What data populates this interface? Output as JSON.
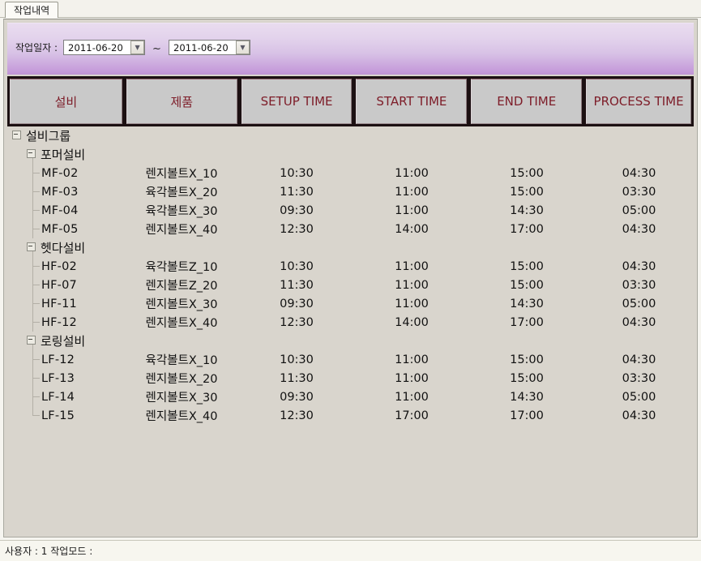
{
  "window": {
    "tab_label": "작업내역"
  },
  "filter": {
    "label": "작업일자 :",
    "date_from": "2011-06-20",
    "date_to": "2011-06-20",
    "separator": "~",
    "dropdown_glyph": "▼",
    "accent_color": "#c79fdb"
  },
  "columns": [
    {
      "key": "equip",
      "label": "설비",
      "korean": true
    },
    {
      "key": "product",
      "label": "제품",
      "korean": true
    },
    {
      "key": "setup",
      "label": "SETUP TIME",
      "korean": false
    },
    {
      "key": "start",
      "label": "START TIME",
      "korean": false
    },
    {
      "key": "end",
      "label": "END TIME",
      "korean": false
    },
    {
      "key": "process",
      "label": "PROCESS TIME",
      "korean": false
    }
  ],
  "header_style": {
    "text_color": "#7d1c28",
    "cell_background": "#c9c9c9",
    "bar_background": "#1c1012"
  },
  "tree": {
    "root_label": "설비그룹",
    "groups": [
      {
        "label": "포머설비",
        "rows": [
          {
            "equip": "MF-02",
            "product": "렌지볼트X_10",
            "setup": "10:30",
            "start": "11:00",
            "end": "15:00",
            "process": "04:30"
          },
          {
            "equip": "MF-03",
            "product": "육각볼트X_20",
            "setup": "11:30",
            "start": "11:00",
            "end": "15:00",
            "process": "03:30"
          },
          {
            "equip": "MF-04",
            "product": "육각볼트X_30",
            "setup": "09:30",
            "start": "11:00",
            "end": "14:30",
            "process": "05:00"
          },
          {
            "equip": "MF-05",
            "product": "렌지볼트X_40",
            "setup": "12:30",
            "start": "14:00",
            "end": "17:00",
            "process": "04:30"
          }
        ]
      },
      {
        "label": "헷다설비",
        "rows": [
          {
            "equip": "HF-02",
            "product": "육각볼트Z_10",
            "setup": "10:30",
            "start": "11:00",
            "end": "15:00",
            "process": "04:30"
          },
          {
            "equip": "HF-07",
            "product": "렌지볼트Z_20",
            "setup": "11:30",
            "start": "11:00",
            "end": "15:00",
            "process": "03:30"
          },
          {
            "equip": "HF-11",
            "product": "렌지볼트X_30",
            "setup": "09:30",
            "start": "11:00",
            "end": "14:30",
            "process": "05:00"
          },
          {
            "equip": "HF-12",
            "product": "렌지볼트X_40",
            "setup": "12:30",
            "start": "14:00",
            "end": "17:00",
            "process": "04:30"
          }
        ]
      },
      {
        "label": "로링설비",
        "rows": [
          {
            "equip": "LF-12",
            "product": "육각볼트X_10",
            "setup": "10:30",
            "start": "11:00",
            "end": "15:00",
            "process": "04:30"
          },
          {
            "equip": "LF-13",
            "product": "렌지볼트X_20",
            "setup": "11:30",
            "start": "11:00",
            "end": "15:00",
            "process": "03:30"
          },
          {
            "equip": "LF-14",
            "product": "렌지볼트X_30",
            "setup": "09:30",
            "start": "11:00",
            "end": "14:30",
            "process": "05:00"
          },
          {
            "equip": "LF-15",
            "product": "렌지볼트X_40",
            "setup": "12:30",
            "start": "17:00",
            "end": "17:00",
            "process": "04:30"
          }
        ]
      }
    ]
  },
  "statusbar": {
    "text": "사용자 : 1 작업모드 :"
  }
}
